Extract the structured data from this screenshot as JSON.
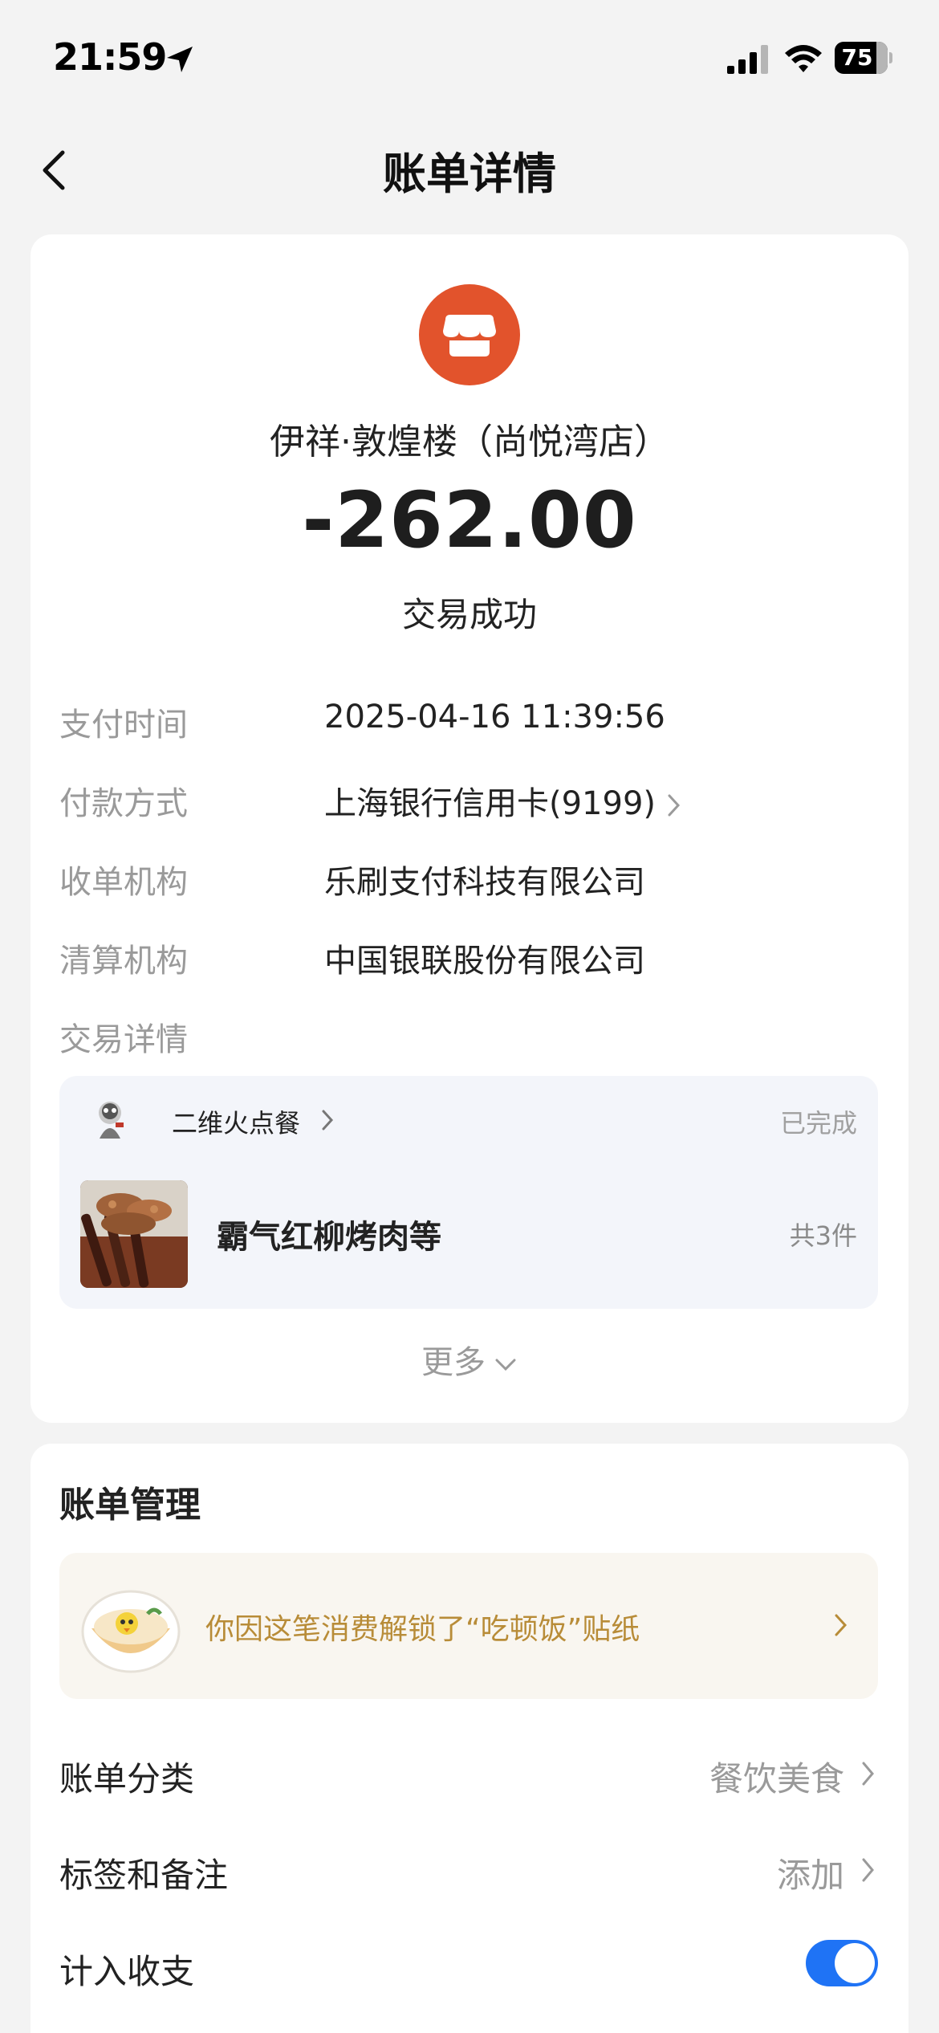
{
  "status_bar": {
    "time": "21:59",
    "battery": "75"
  },
  "nav": {
    "title": "账单详情"
  },
  "merchant": {
    "name": "伊祥·敦煌楼（尚悦湾店）",
    "amount": "-262.00",
    "status": "交易成功"
  },
  "details": [
    {
      "label": "支付时间",
      "value": "2025-04-16 11:39:56"
    },
    {
      "label": "付款方式",
      "value": "上海银行信用卡(9199)"
    },
    {
      "label": "收单机构",
      "value": "乐刷支付科技有限公司"
    },
    {
      "label": "清算机构",
      "value": "中国银联股份有限公司"
    },
    {
      "label": "交易详情",
      "value": ""
    }
  ],
  "order": {
    "source": "二维火点餐",
    "status": "已完成",
    "title": "霸气红柳烤肉等",
    "count": "共3件"
  },
  "more_label": "更多",
  "manage": {
    "title": "账单管理",
    "sticker_text": "你因这笔消费解锁了“吃顿饭”贴纸",
    "category_label": "账单分类",
    "category_value": "餐饮美食",
    "tags_label": "标签和备注",
    "tags_value": "添加",
    "include_label": "计入收支",
    "include_on": true
  },
  "colors": {
    "accent": "#1f73f5",
    "merchant_logo": "#e2532c",
    "sticker_text": "#b88c38"
  },
  "icons": [
    "location-arrow-icon",
    "cellular-signal-icon",
    "wifi-icon",
    "battery-icon",
    "back-chevron-icon",
    "store-icon",
    "chevron-right-icon",
    "chevron-down-icon"
  ]
}
